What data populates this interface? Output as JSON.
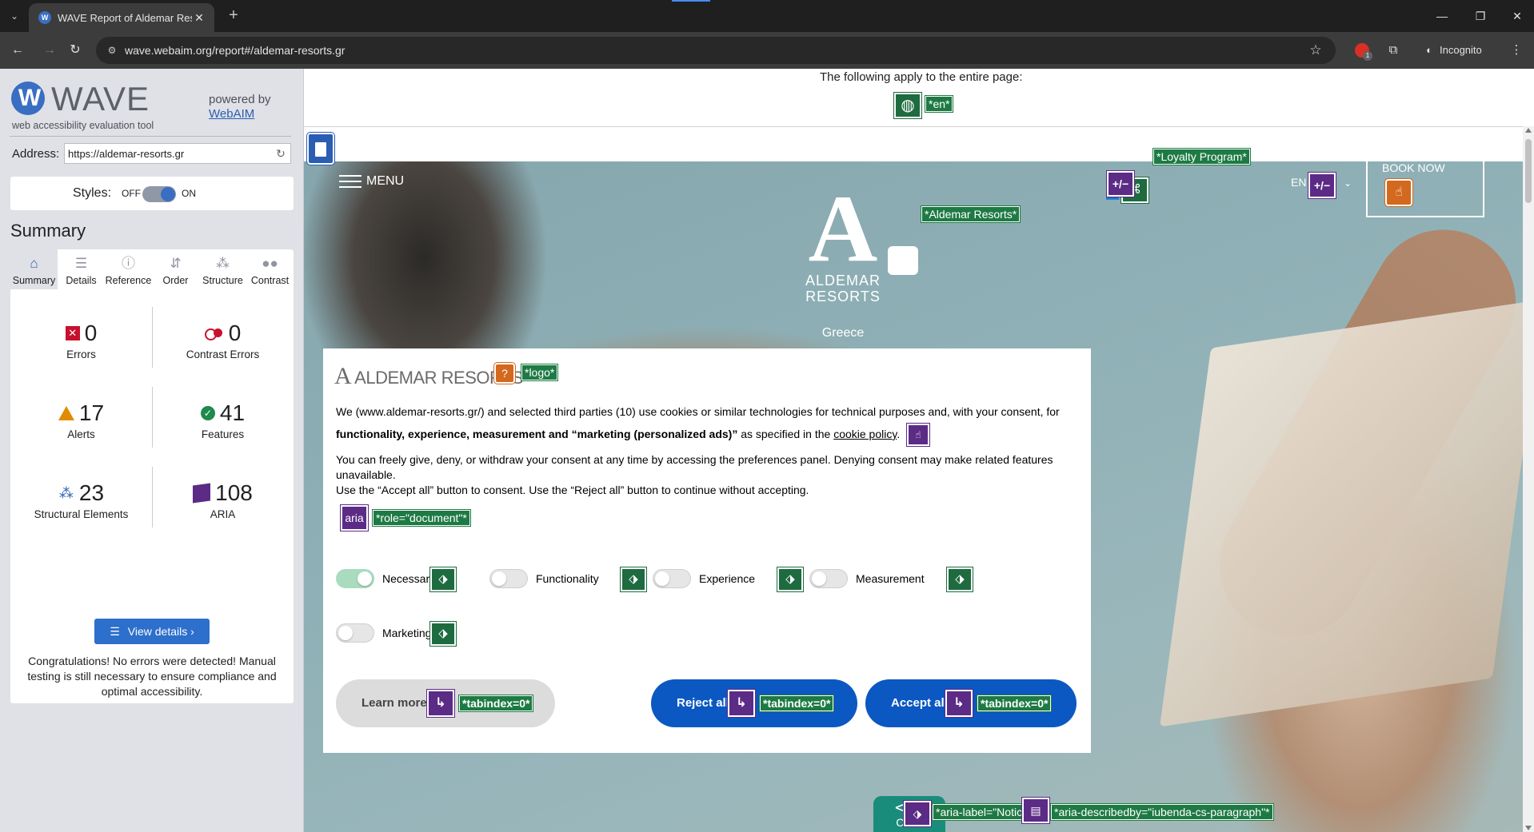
{
  "browser": {
    "tab_title": "WAVE Report of Aldemar Resor",
    "tab_favicon": "W",
    "url": "wave.webaim.org/report#/aldemar-resorts.gr",
    "incognito_label": "Incognito",
    "extension_badge": "1",
    "icons": {
      "tab_list": "chevron-down-icon",
      "tab_close": "close-icon",
      "new_tab": "plus-icon",
      "back": "arrow-left-icon",
      "forward": "arrow-right-icon",
      "reload": "reload-icon",
      "site_info": "tune-icon",
      "bookmark": "star-icon",
      "extensions": "puzzle-icon",
      "menu": "kebab-icon"
    }
  },
  "wave": {
    "logo_text": "WAVE",
    "tagline": "web accessibility evaluation tool",
    "powered_by": "powered by",
    "webaim_link": "WebAIM",
    "address_label": "Address:",
    "address_value": "https://aldemar-resorts.gr",
    "styles_label": "Styles:",
    "styles_off": "OFF",
    "styles_on": "ON",
    "summary_heading": "Summary",
    "tabs": [
      {
        "label": "Summary",
        "icon": "home-icon"
      },
      {
        "label": "Details",
        "icon": "list-icon"
      },
      {
        "label": "Reference",
        "icon": "info-icon"
      },
      {
        "label": "Order",
        "icon": "order-icon"
      },
      {
        "label": "Structure",
        "icon": "structure-icon"
      },
      {
        "label": "Contrast",
        "icon": "contrast-icon"
      }
    ],
    "stats": {
      "errors": {
        "value": "0",
        "label": "Errors"
      },
      "contrast_errors": {
        "value": "0",
        "label": "Contrast Errors"
      },
      "alerts": {
        "value": "17",
        "label": "Alerts"
      },
      "features": {
        "value": "41",
        "label": "Features"
      },
      "structural": {
        "value": "23",
        "label": "Structural Elements"
      },
      "aria": {
        "value": "108",
        "label": "ARIA"
      }
    },
    "view_details": "View details ›",
    "congrats": "Congratulations! No errors were detected! Manual testing is still necessary to ensure compliance and optimal accessibility."
  },
  "page": {
    "apply_text": "The following apply to the entire page:",
    "lang_tag": "*en*",
    "menu_label": "MENU",
    "brand_a": "A",
    "brand_name_1": "ALDEMAR",
    "brand_name_2": "RESORTS",
    "brand_sub": "Greece",
    "brand_tag": "*Aldemar Resorts*",
    "loyalty_tag": "*Loyalty Program*",
    "plusminus": "+/−",
    "lang_en": "EN",
    "book_now": "BOOK NOW",
    "cookie": {
      "logo_text": "ALDEMAR RESORTS",
      "logo_a": "A",
      "logo_tag": "*logo*",
      "p1": "We (www.aldemar-resorts.gr/) and selected third parties (10) use cookies or similar technologies for technical purposes and, with your consent, for",
      "p2_bold": "functionality, experience, measurement and “marketing (personalized ads)”",
      "p2_rest": " as specified in the ",
      "policy_link": "cookie policy",
      "p2_end": ".",
      "p3": "You can freely give, deny, or withdraw your consent at any time by accessing the preferences panel. Denying consent may make related features unavailable.",
      "p4": "Use the “Accept all” button to consent. Use the “Reject all” button to continue without accepting.",
      "aria_chip": "aria",
      "role_tag": "*role=\"document\"*",
      "toggles": [
        {
          "label": "Necessary",
          "on": true
        },
        {
          "label": "Functionality",
          "on": false
        },
        {
          "label": "Experience",
          "on": false
        },
        {
          "label": "Measurement",
          "on": false
        },
        {
          "label": "Marketing",
          "on": false
        }
      ],
      "learn_more": "Learn more",
      "reject_all": "Reject all",
      "accept_all": "Accept all",
      "tabindex_tag": "*tabindex=0*"
    },
    "code_glyph": "</>",
    "code_label": "Code",
    "notice_tag": "*aria-label=\"Notice\"*",
    "describedby_tag": "*aria-describedby=\"iubenda-cs-paragraph\"*"
  },
  "colors": {
    "wave_blue": "#2b5eb3",
    "wave_green": "#1e6b3f",
    "wave_purple": "#5b2b86",
    "error_red": "#c8102e",
    "alert_orange": "#e28b00",
    "cookie_button_blue": "#0b58c2"
  }
}
